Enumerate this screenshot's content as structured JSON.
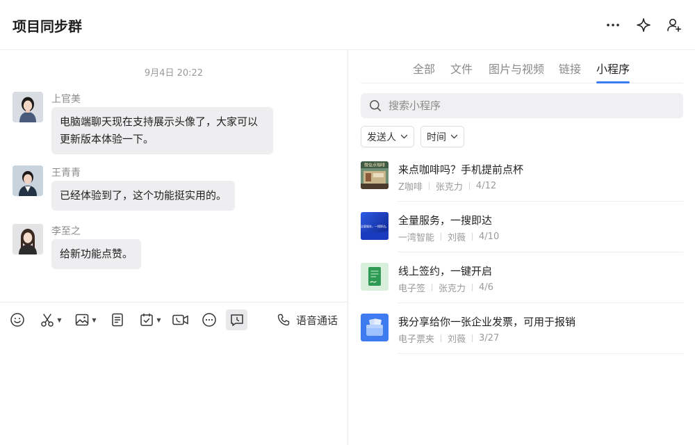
{
  "header": {
    "title": "项目同步群",
    "more_icon": "more-icon",
    "ai_icon": "sparkle-icon",
    "add_member_icon": "add-member-icon"
  },
  "chat": {
    "timestamp": "9月4日 20:22",
    "messages": [
      {
        "sender": "上官美",
        "text": "电脑端聊天现在支持展示头像了，大家可以更新版本体验一下。"
      },
      {
        "sender": "王青青",
        "text": "已经体验到了，这个功能挺实用的。"
      },
      {
        "sender": "李至之",
        "text": "给新功能点赞。"
      }
    ],
    "toolbar": {
      "voice_call": "语音通话"
    }
  },
  "side": {
    "tabs": [
      "全部",
      "文件",
      "图片与视频",
      "链接",
      "小程序"
    ],
    "active_tab": "小程序",
    "search_placeholder": "搜索小程序",
    "filters": [
      "发送人",
      "时间"
    ],
    "apps": [
      {
        "title": "来点咖啡吗？手机提前点杯",
        "source": "Z咖啡",
        "sender": "张克力",
        "date": "4/12",
        "icon_label": "微信点咖啡"
      },
      {
        "title": "全量服务，一搜即达",
        "source": "一湾智能",
        "sender": "刘薇",
        "date": "4/10",
        "icon_label": "全量服务，一搜即达。"
      },
      {
        "title": "线上签约，一键开启",
        "source": "电子签",
        "sender": "张克力",
        "date": "4/6"
      },
      {
        "title": "我分享给你一张企业发票，可用于报销",
        "source": "电子票夹",
        "sender": "刘薇",
        "date": "3/27"
      }
    ]
  },
  "colors": {
    "accent": "#3a7bf2",
    "bubble": "#eeeef0"
  }
}
